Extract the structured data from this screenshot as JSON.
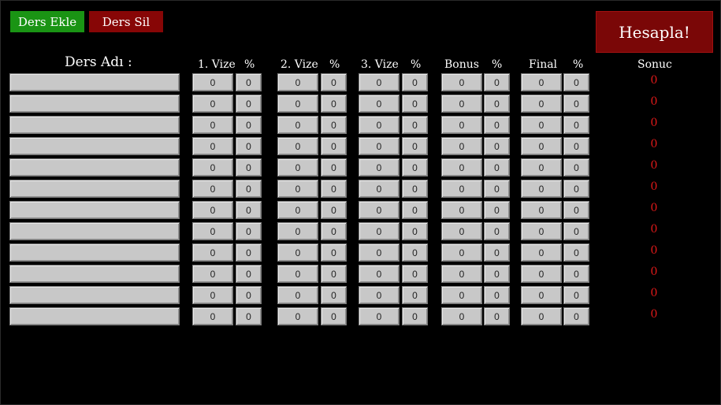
{
  "buttons": {
    "add": "Ders Ekle",
    "remove": "Ders Sil",
    "calculate": "Hesapla!"
  },
  "headers": {
    "course_name": "Ders Adı :",
    "vize1": "1. Vize",
    "vize2": "2. Vize",
    "vize3": "3. Vize",
    "bonus": "Bonus",
    "final": "Final",
    "percent": "%",
    "result": "Sonuc"
  },
  "rows": [
    {
      "name": "",
      "vize1": "0",
      "vize1_pct": "0",
      "vize2": "0",
      "vize2_pct": "0",
      "vize3": "0",
      "vize3_pct": "0",
      "bonus": "0",
      "bonus_pct": "0",
      "final": "0",
      "final_pct": "0",
      "result": "0"
    },
    {
      "name": "",
      "vize1": "0",
      "vize1_pct": "0",
      "vize2": "0",
      "vize2_pct": "0",
      "vize3": "0",
      "vize3_pct": "0",
      "bonus": "0",
      "bonus_pct": "0",
      "final": "0",
      "final_pct": "0",
      "result": "0"
    },
    {
      "name": "",
      "vize1": "0",
      "vize1_pct": "0",
      "vize2": "0",
      "vize2_pct": "0",
      "vize3": "0",
      "vize3_pct": "0",
      "bonus": "0",
      "bonus_pct": "0",
      "final": "0",
      "final_pct": "0",
      "result": "0"
    },
    {
      "name": "",
      "vize1": "0",
      "vize1_pct": "0",
      "vize2": "0",
      "vize2_pct": "0",
      "vize3": "0",
      "vize3_pct": "0",
      "bonus": "0",
      "bonus_pct": "0",
      "final": "0",
      "final_pct": "0",
      "result": "0"
    },
    {
      "name": "",
      "vize1": "0",
      "vize1_pct": "0",
      "vize2": "0",
      "vize2_pct": "0",
      "vize3": "0",
      "vize3_pct": "0",
      "bonus": "0",
      "bonus_pct": "0",
      "final": "0",
      "final_pct": "0",
      "result": "0"
    },
    {
      "name": "",
      "vize1": "0",
      "vize1_pct": "0",
      "vize2": "0",
      "vize2_pct": "0",
      "vize3": "0",
      "vize3_pct": "0",
      "bonus": "0",
      "bonus_pct": "0",
      "final": "0",
      "final_pct": "0",
      "result": "0"
    },
    {
      "name": "",
      "vize1": "0",
      "vize1_pct": "0",
      "vize2": "0",
      "vize2_pct": "0",
      "vize3": "0",
      "vize3_pct": "0",
      "bonus": "0",
      "bonus_pct": "0",
      "final": "0",
      "final_pct": "0",
      "result": "0"
    },
    {
      "name": "",
      "vize1": "0",
      "vize1_pct": "0",
      "vize2": "0",
      "vize2_pct": "0",
      "vize3": "0",
      "vize3_pct": "0",
      "bonus": "0",
      "bonus_pct": "0",
      "final": "0",
      "final_pct": "0",
      "result": "0"
    },
    {
      "name": "",
      "vize1": "0",
      "vize1_pct": "0",
      "vize2": "0",
      "vize2_pct": "0",
      "vize3": "0",
      "vize3_pct": "0",
      "bonus": "0",
      "bonus_pct": "0",
      "final": "0",
      "final_pct": "0",
      "result": "0"
    },
    {
      "name": "",
      "vize1": "0",
      "vize1_pct": "0",
      "vize2": "0",
      "vize2_pct": "0",
      "vize3": "0",
      "vize3_pct": "0",
      "bonus": "0",
      "bonus_pct": "0",
      "final": "0",
      "final_pct": "0",
      "result": "0"
    },
    {
      "name": "",
      "vize1": "0",
      "vize1_pct": "0",
      "vize2": "0",
      "vize2_pct": "0",
      "vize3": "0",
      "vize3_pct": "0",
      "bonus": "0",
      "bonus_pct": "0",
      "final": "0",
      "final_pct": "0",
      "result": "0"
    },
    {
      "name": "",
      "vize1": "0",
      "vize1_pct": "0",
      "vize2": "0",
      "vize2_pct": "0",
      "vize3": "0",
      "vize3_pct": "0",
      "bonus": "0",
      "bonus_pct": "0",
      "final": "0",
      "final_pct": "0",
      "result": "0"
    }
  ]
}
